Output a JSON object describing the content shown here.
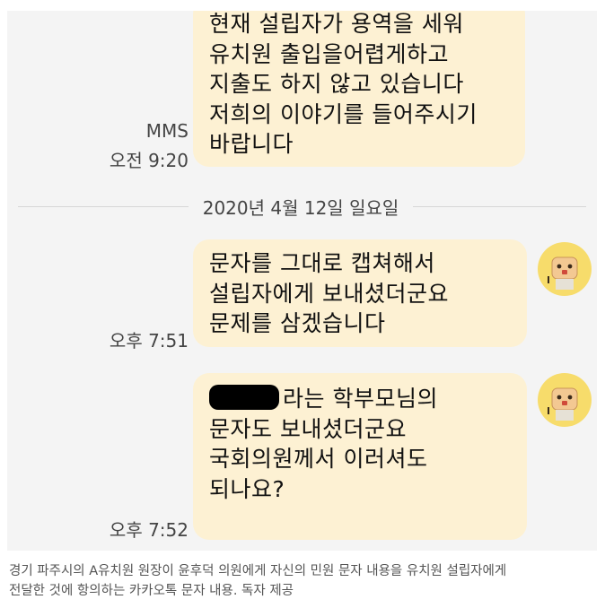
{
  "chat": {
    "top_bubble": {
      "lines": [
        "현재 설립자가 용역을 세워",
        "유치원 출입을어렵게하고",
        "지출도 하지 않고 있습니다",
        "저희의 이야기를 들어주시기",
        "바랍니다"
      ],
      "type_label": "MMS",
      "time": "오전 9:20"
    },
    "date_divider": "2020년 4월 12일 일요일",
    "messages": [
      {
        "lines": [
          "문자를 그대로 캡쳐해서",
          "설립자에게 보내셨더군요",
          "문제를 삼겠습니다"
        ],
        "time": "오후 7:51"
      },
      {
        "first_line_suffix": "라는 학부모님의",
        "lines": [
          "문자도 보내셨더군요",
          "국회의원께서 이러셔도",
          "되나요?"
        ],
        "time": "오후 7:52"
      }
    ],
    "bubble_color": "#fdf1d3",
    "avatar_color": "#f7dc6b"
  },
  "caption": {
    "lines": [
      "경기 파주시의 A유치원 원장이 윤후덕 의원에게 자신의 민원 문자 내용을 유치원 설립자에게",
      "전달한 것에 항의하는 카카오톡 문자 내용. 독자 제공"
    ]
  }
}
